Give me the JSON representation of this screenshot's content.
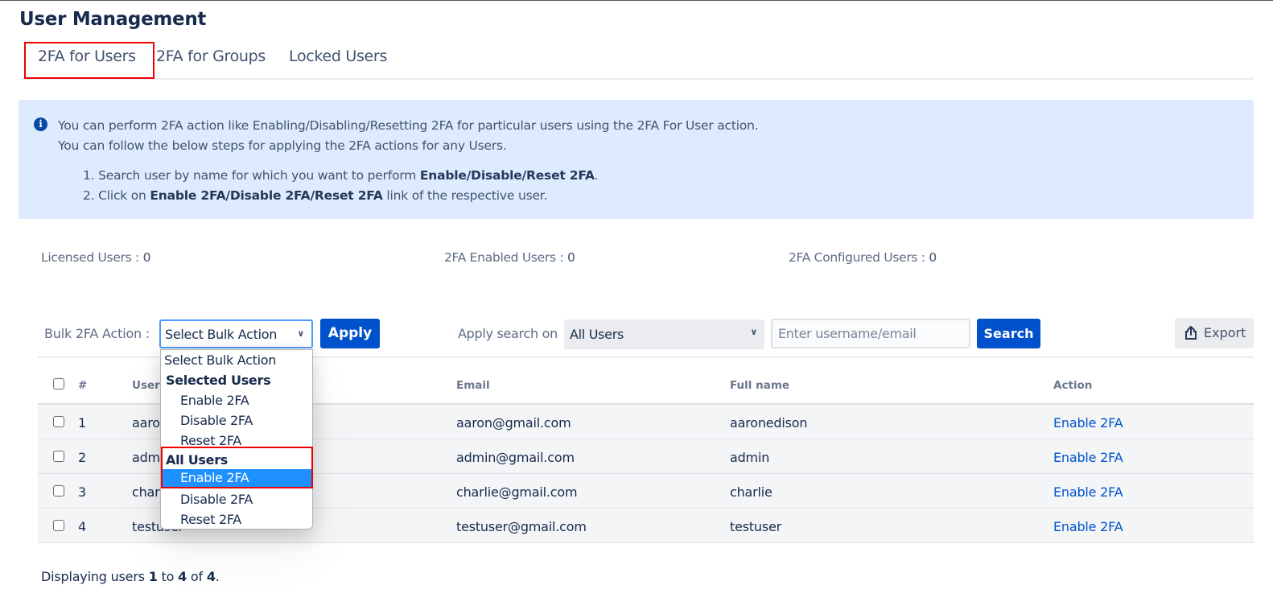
{
  "page": {
    "title": "User Management"
  },
  "tabs": [
    {
      "label": "2FA for Users",
      "active": true
    },
    {
      "label": "2FA for Groups",
      "active": false
    },
    {
      "label": "Locked Users",
      "active": false
    }
  ],
  "info": {
    "icon": "info-icon",
    "line1": "You can perform 2FA action like Enabling/Disabling/Resetting 2FA for particular users using the 2FA For User action.",
    "line2": "You can follow the below steps for applying the 2FA actions for any Users.",
    "step1_prefix": "1. Search user by name for which you want to perform ",
    "step1_bold": "Enable/Disable/Reset 2FA",
    "step1_suffix": ".",
    "step2_prefix": "2. Click on ",
    "step2_bold": "Enable 2FA/Disable 2FA/Reset 2FA",
    "step2_suffix": " link of the respective user."
  },
  "stats": {
    "licensed_label": "Licensed Users : ",
    "licensed_value": "0",
    "enabled_label": "2FA Enabled Users : ",
    "enabled_value": "0",
    "configured_label": "2FA Configured Users : ",
    "configured_value": "0"
  },
  "toolbar": {
    "bulk_label": "Bulk 2FA Action :",
    "bulk_selected": "Select Bulk Action",
    "apply_label": "Apply",
    "search_on_label": "Apply search on",
    "search_scope": "All Users",
    "search_placeholder": "Enter username/email",
    "search_value": "",
    "search_label": "Search",
    "export_label": "Export"
  },
  "bulk_options": [
    {
      "label": "Select Bulk Action",
      "type": "option"
    },
    {
      "label": "Selected Users",
      "type": "group"
    },
    {
      "label": "Enable 2FA",
      "type": "option",
      "group": "Selected Users"
    },
    {
      "label": "Disable 2FA",
      "type": "option",
      "group": "Selected Users"
    },
    {
      "label": "Reset 2FA",
      "type": "option",
      "group": "Selected Users"
    },
    {
      "label": "All Users",
      "type": "group"
    },
    {
      "label": "Enable 2FA",
      "type": "option",
      "group": "All Users",
      "highlighted": true
    },
    {
      "label": "Disable 2FA",
      "type": "option",
      "group": "All Users"
    },
    {
      "label": "Reset 2FA",
      "type": "option",
      "group": "All Users"
    }
  ],
  "table": {
    "headers": {
      "num": "#",
      "username": "Username",
      "email": "Email",
      "fullname": "Full name",
      "action": "Action"
    },
    "rows": [
      {
        "num": "1",
        "username": "aaron",
        "email": "aaron@gmail.com",
        "fullname": "aaronedison",
        "action": "Enable 2FA"
      },
      {
        "num": "2",
        "username": "admin",
        "email": "admin@gmail.com",
        "fullname": "admin",
        "action": "Enable 2FA"
      },
      {
        "num": "3",
        "username": "charlie",
        "email": "charlie@gmail.com",
        "fullname": "charlie",
        "action": "Enable 2FA"
      },
      {
        "num": "4",
        "username": "testuser",
        "email": "testuser@gmail.com",
        "fullname": "testuser",
        "action": "Enable 2FA"
      }
    ]
  },
  "footer": {
    "prefix": "Displaying users ",
    "from": "1",
    "to_word": " to ",
    "to": "4",
    "of_word": " of ",
    "total": "4",
    "suffix": "."
  },
  "colors": {
    "primary": "#0052cc",
    "info_bg": "#deebff",
    "highlight": "#e00000",
    "option_selected": "#1e90ff"
  }
}
